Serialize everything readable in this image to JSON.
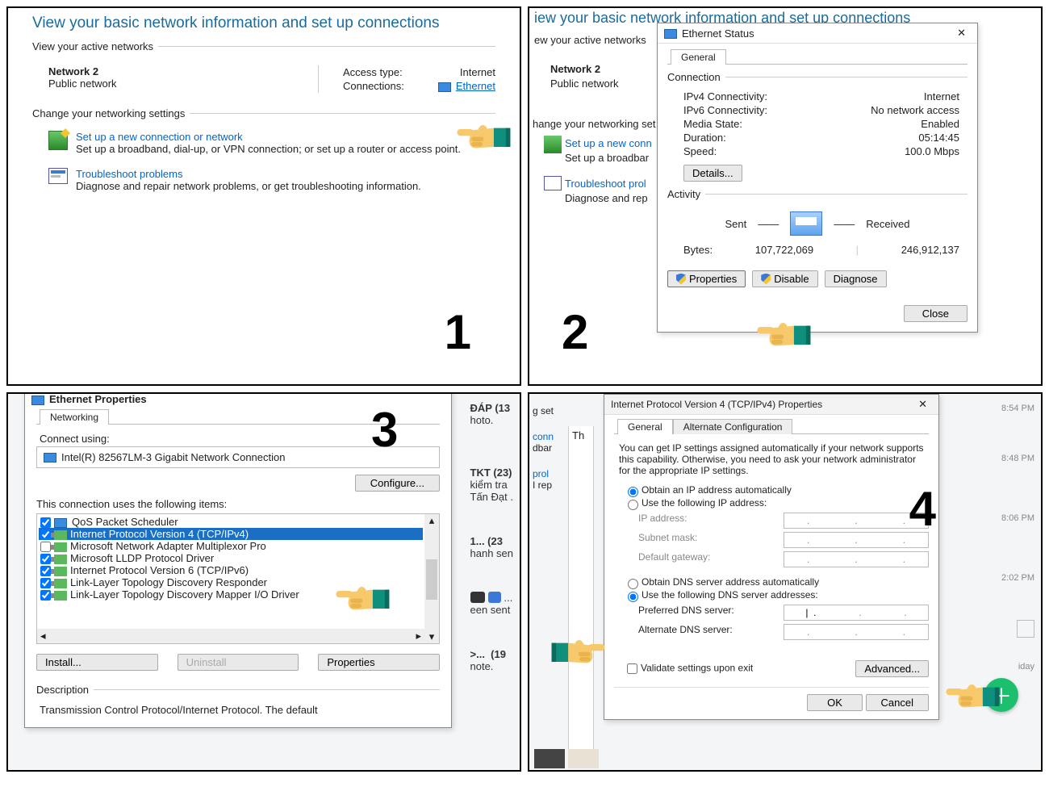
{
  "panel1": {
    "heading": "View your basic network information and set up connections",
    "active_legend": "View your active networks",
    "net_name": "Network 2",
    "net_type": "Public network",
    "access_label": "Access type:",
    "access_value": "Internet",
    "conn_label": "Connections:",
    "conn_link": "Ethernet",
    "change_legend": "Change your networking settings",
    "setup_link": "Set up a new connection or network",
    "setup_desc": "Set up a broadband, dial-up, or VPN connection; or set up a router or access point.",
    "trouble_link": "Troubleshoot problems",
    "trouble_desc": "Diagnose and repair network problems, or get troubleshooting information."
  },
  "panel2": {
    "bg_heading": "iew your basic network information and set up connections",
    "bg_active": "ew your active networks",
    "bg_net_name": "Network 2",
    "bg_net_type": "Public network",
    "bg_change": "hange your networking set",
    "bg_setup": "Set up a new conn",
    "bg_setup2": "Set up a broadbar",
    "bg_trouble": "Troubleshoot prol",
    "bg_trouble2": "Diagnose and rep",
    "dlg_title": "Ethernet Status",
    "tab_general": "General",
    "legend_conn": "Connection",
    "rows": {
      "ipv4_l": "IPv4 Connectivity:",
      "ipv4_v": "Internet",
      "ipv6_l": "IPv6 Connectivity:",
      "ipv6_v": "No network access",
      "media_l": "Media State:",
      "media_v": "Enabled",
      "dur_l": "Duration:",
      "dur_v": "05:14:45",
      "spd_l": "Speed:",
      "spd_v": "100.0 Mbps"
    },
    "btn_details": "Details...",
    "legend_activity": "Activity",
    "sent": "Sent",
    "recv": "Received",
    "bytes_l": "Bytes:",
    "bytes_sent": "107,722,069",
    "bytes_recv": "246,912,137",
    "btn_props": "Properties",
    "btn_disable": "Disable",
    "btn_diag": "Diagnose",
    "btn_close": "Close"
  },
  "panel3": {
    "dlg_title": "Ethernet Properties",
    "tab_networking": "Networking",
    "connect_using": "Connect using:",
    "adapter": "Intel(R) 82567LM-3 Gigabit Network Connection",
    "btn_configure": "Configure...",
    "items_label": "This connection uses the following items:",
    "items": [
      "QoS Packet Scheduler",
      "Internet Protocol Version 4 (TCP/IPv4)",
      "Microsoft Network Adapter Multiplexor Pro",
      "Microsoft LLDP Protocol Driver",
      "Internet Protocol Version 6 (TCP/IPv6)",
      "Link-Layer Topology Discovery Responder",
      "Link-Layer Topology Discovery Mapper I/O Driver"
    ],
    "btn_install": "Install...",
    "btn_uninstall": "Uninstall",
    "btn_props": "Properties",
    "legend_desc": "Description",
    "desc_text": "Transmission Control Protocol/Internet Protocol. The default",
    "bg_dap": "ĐÁP (13",
    "bg_hoto": "hoto.",
    "bg_tkt": "TKT (23)",
    "bg_kiem": "kiểm tra",
    "bg_tan": "Tấn Đạt .",
    "bg_1": "1...   (23",
    "bg_hanh": "hanh sen",
    "bg_een": "een sent",
    "bg_19": "(19",
    "bg_note": "note.",
    "bg_dots": ">..."
  },
  "panel4": {
    "dlg_title": "Internet Protocol Version 4 (TCP/IPv4) Properties",
    "tab_general": "General",
    "tab_alt": "Alternate Configuration",
    "intro": "You can get IP settings assigned automatically if your network supports this capability. Otherwise, you need to ask your network administrator for the appropriate IP settings.",
    "r_auto_ip": "Obtain an IP address automatically",
    "r_use_ip": "Use the following IP address:",
    "ip_l": "IP address:",
    "mask_l": "Subnet mask:",
    "gw_l": "Default gateway:",
    "r_auto_dns": "Obtain DNS server address automatically",
    "r_use_dns": "Use the following DNS server addresses:",
    "pref_l": "Preferred DNS server:",
    "alt_l": "Alternate DNS server:",
    "validate": "Validate settings upon exit",
    "btn_adv": "Advanced...",
    "btn_ok": "OK",
    "btn_cancel": "Cancel",
    "bg_gset": "g set",
    "bg_conn": "conn",
    "bg_dbar": "dbar",
    "bg_prol": "prol",
    "bg_rep": "I rep",
    "bg_th": "Th",
    "ts1": "8:54 PM",
    "ts2": "8:48 PM",
    "ts3": "8:06 PM",
    "ts4": "2:02 PM",
    "ts5": "iday"
  },
  "nums": {
    "n1": "1",
    "n2": "2",
    "n3": "3",
    "n4": "4"
  }
}
